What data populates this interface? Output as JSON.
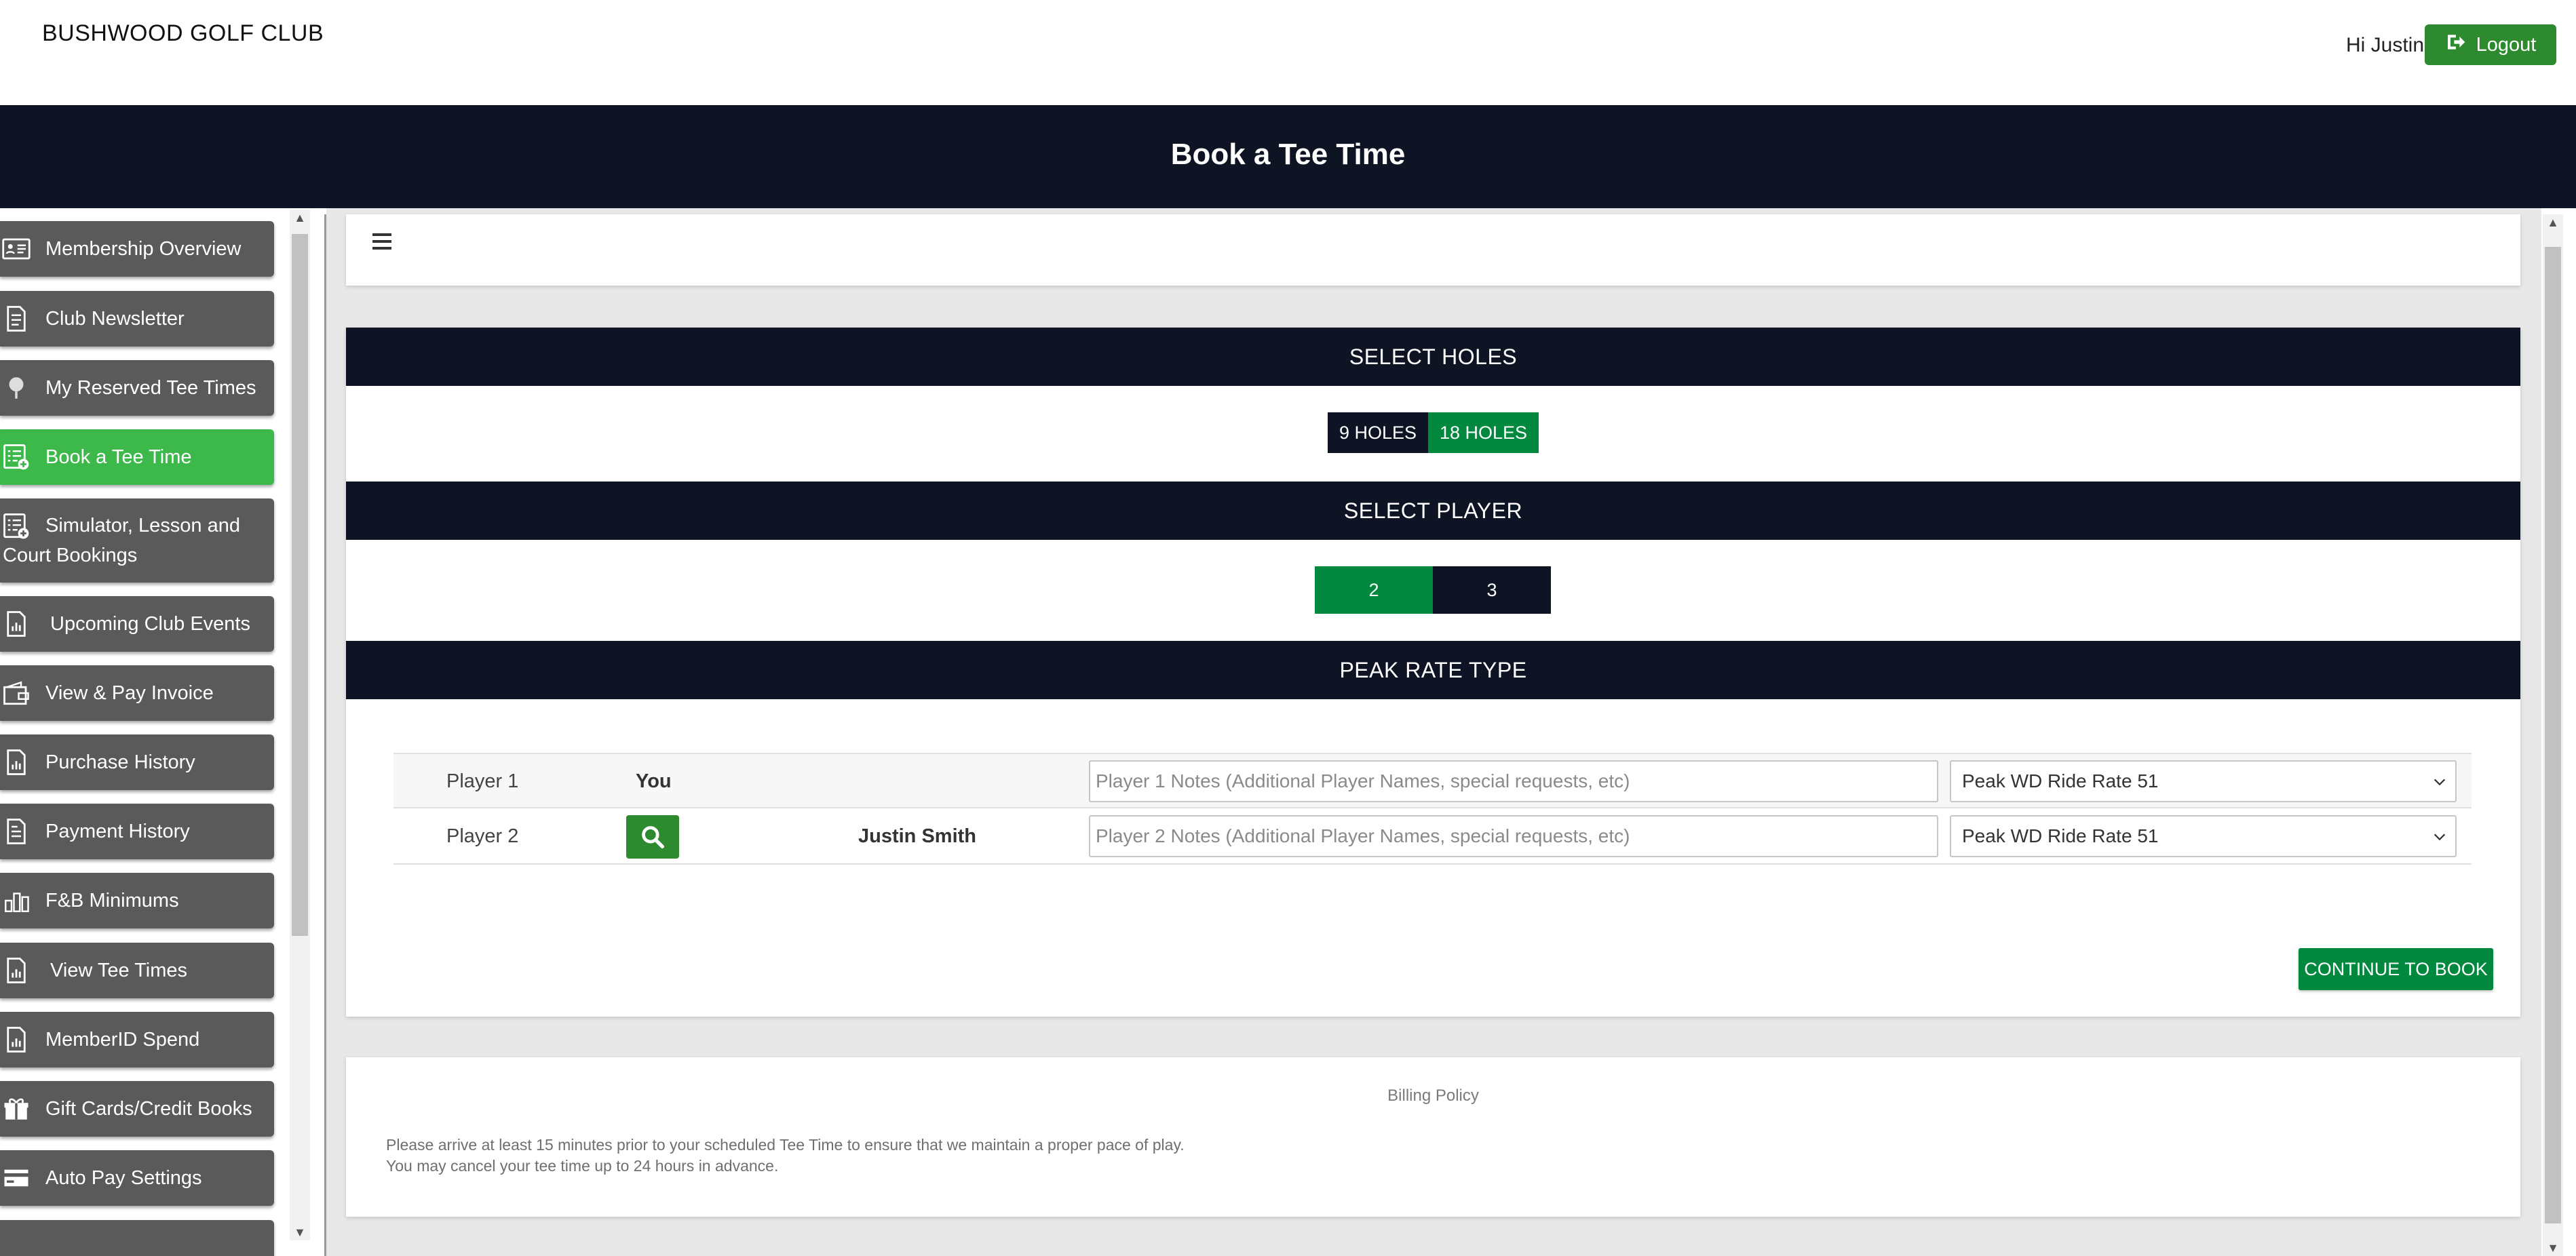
{
  "header": {
    "brand": "BUSHWOOD GOLF CLUB",
    "greeting": "Hi Justin",
    "logout_label": "Logout",
    "logout_color": "#2d8a2f"
  },
  "banner": {
    "title": "Book a Tee Time"
  },
  "sidebar": {
    "items": [
      {
        "label": "Membership Overview",
        "icon": "id-card-icon"
      },
      {
        "label": "Club Newsletter",
        "icon": "document-icon"
      },
      {
        "label": "My Reserved Tee Times",
        "icon": "golf-ball-icon"
      },
      {
        "label": "Book a Tee Time",
        "icon": "list-add-icon",
        "active": true
      },
      {
        "label": "Simulator, Lesson and Court Bookings",
        "icon": "list-add-icon"
      },
      {
        "label": "Upcoming Club Events",
        "icon": "report-icon"
      },
      {
        "label": "View & Pay Invoice",
        "icon": "wallet-icon"
      },
      {
        "label": "Purchase History",
        "icon": "report-icon"
      },
      {
        "label": "Payment History",
        "icon": "receipt-icon"
      },
      {
        "label": "F&B Minimums",
        "icon": "chart-icon"
      },
      {
        "label": "View Tee Times",
        "icon": "report-icon"
      },
      {
        "label": "MemberID Spend",
        "icon": "report-icon"
      },
      {
        "label": "Gift Cards/Credit Books",
        "icon": "gift-icon"
      },
      {
        "label": "Auto Pay Settings",
        "icon": "credit-card-icon"
      }
    ],
    "active_color": "#3cb94a",
    "item_color": "#5a5a5a"
  },
  "select_holes": {
    "title": "SELECT HOLES",
    "options": [
      "9 HOLES",
      "18 HOLES"
    ],
    "selected": "18 HOLES"
  },
  "select_player": {
    "title": "SELECT PLAYER",
    "options": [
      "2",
      "3"
    ],
    "selected": "2"
  },
  "peak_rate": {
    "title": "PEAK RATE TYPE",
    "players": [
      {
        "label": "Player 1",
        "who": "You",
        "name": "",
        "notes_placeholder": "Player 1 Notes (Additional Player Names, special requests, etc)",
        "rate": "Peak WD Ride Rate 51"
      },
      {
        "label": "Player 2",
        "who": "",
        "name": "Justin Smith",
        "notes_placeholder": "Player 2 Notes (Additional Player Names, special requests, etc)",
        "rate": "Peak WD Ride Rate 51"
      }
    ],
    "continue_label": "CONTINUE TO BOOK"
  },
  "billing": {
    "title": "Billing Policy",
    "lines": [
      "Please arrive at least 15 minutes prior to your scheduled Tee Time to ensure that we maintain a proper pace of play.",
      "You may cancel your tee time up to 24 hours in advance."
    ]
  },
  "colors": {
    "navy": "#0f1424",
    "green": "#00883e"
  }
}
